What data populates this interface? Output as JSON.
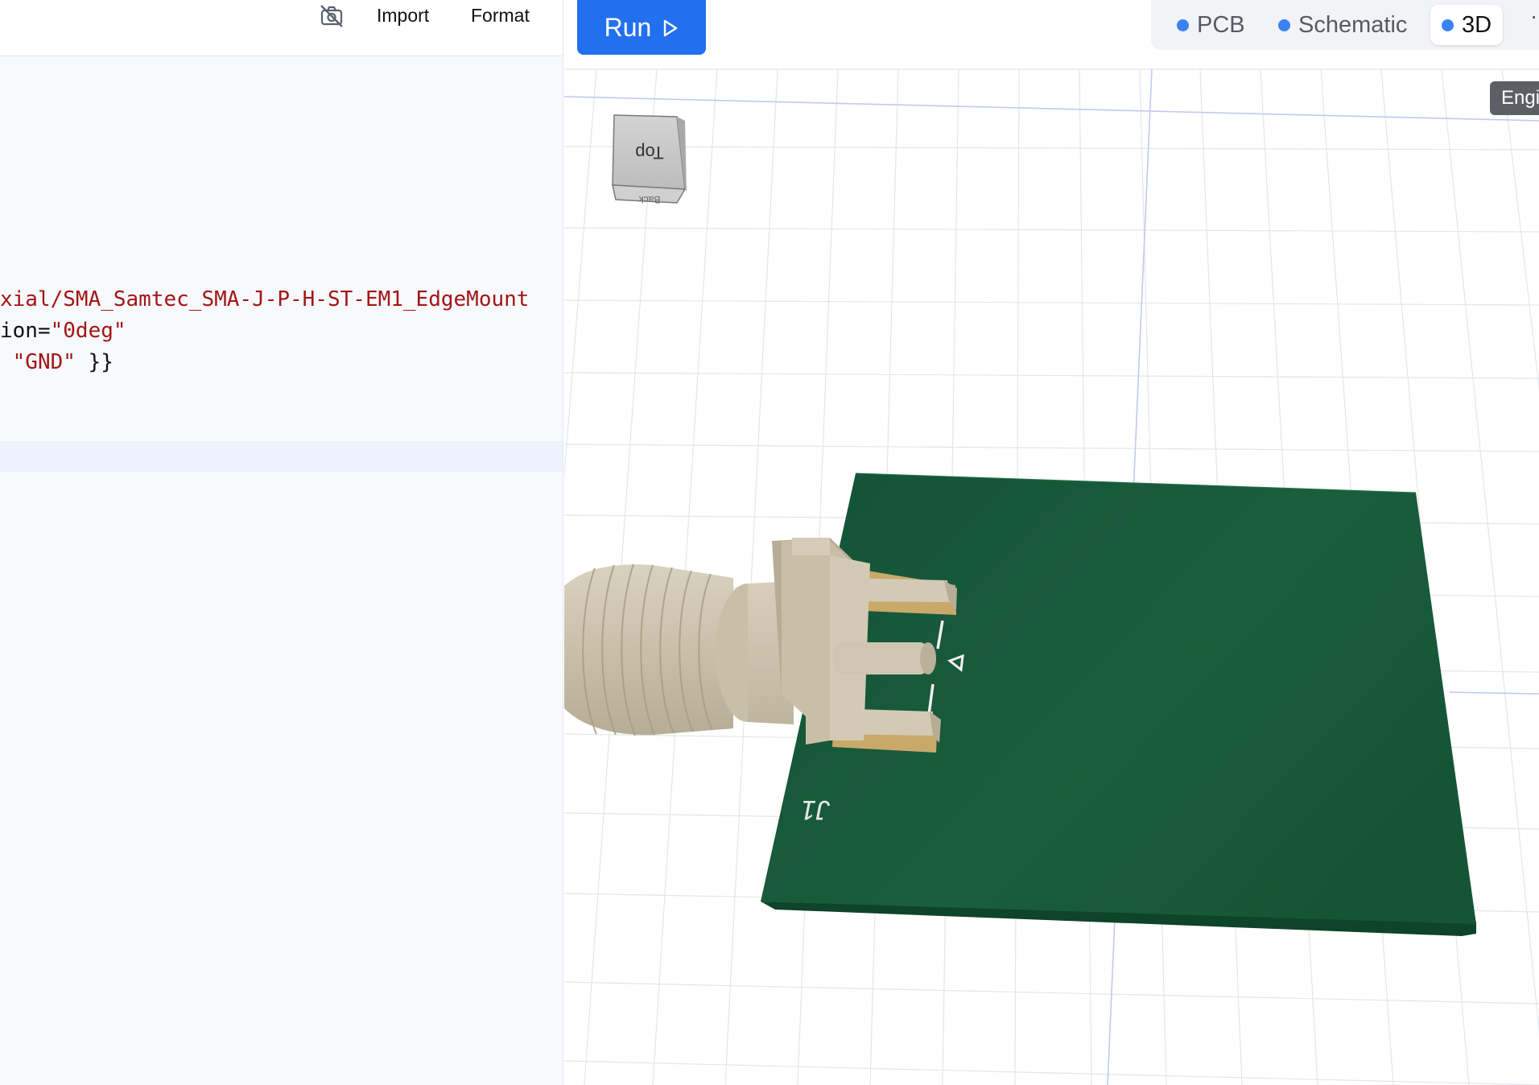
{
  "toolbar": {
    "icon": "camera-off-icon",
    "import_label": "Import",
    "format_label": "Format"
  },
  "code": {
    "line1": "xial/SMA_Samtec_SMA-J-P-H-ST-EM1_EdgeMount",
    "line2_prefix": "ion=",
    "line2_value": "\"0deg\"",
    "line3_value": " \"GND\"",
    "line3_suffix": " }}"
  },
  "run": {
    "label": "Run",
    "icon": "play-icon",
    "color": "#2370ee"
  },
  "tabs": [
    {
      "label": "PCB",
      "active": false
    },
    {
      "label": "Schematic",
      "active": false
    },
    {
      "label": "3D",
      "active": true
    }
  ],
  "tab_dot_color": "#3b82f6",
  "more_label": "··",
  "engine_label": "Engi",
  "viewcube": {
    "top_label": "Top",
    "front_label": "Back"
  },
  "board": {
    "silkscreen_ref": "J1",
    "color": "#175a3a"
  }
}
